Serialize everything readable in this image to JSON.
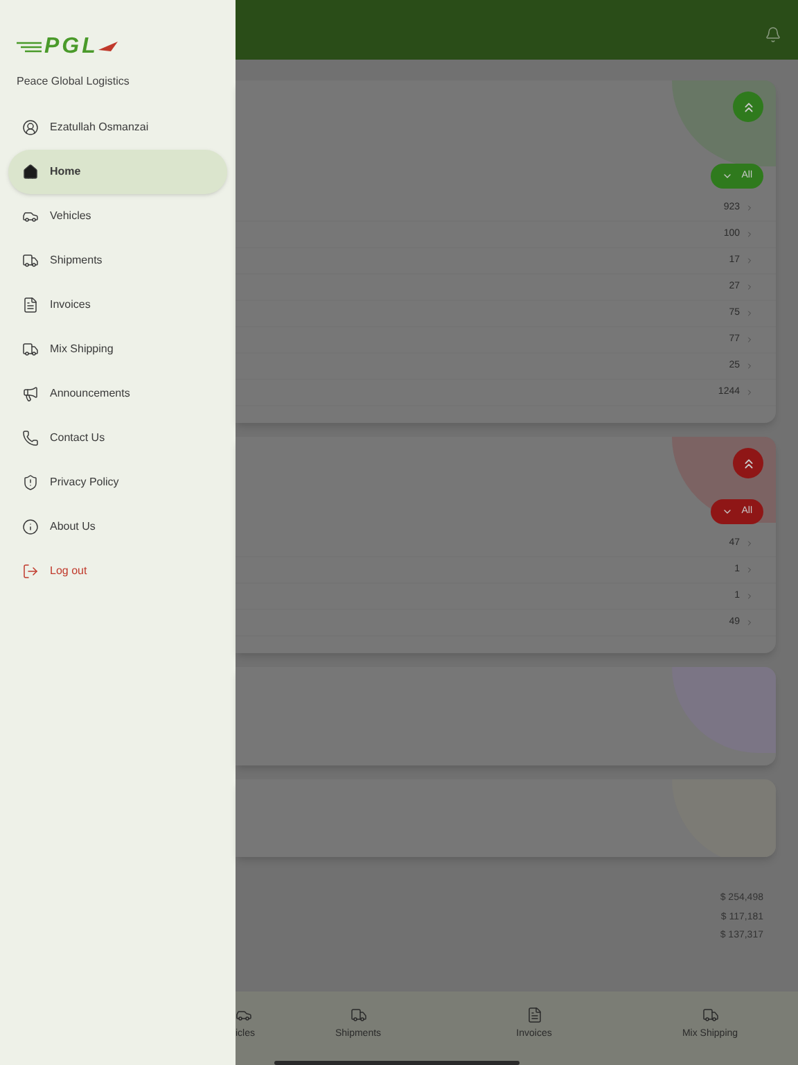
{
  "drawer": {
    "logo_text": "PGL",
    "company": "Peace Global Logistics",
    "items": [
      {
        "kind": "user",
        "label": "Ezatullah Osmanzai",
        "selected": false
      },
      {
        "kind": "link",
        "label": "Home",
        "selected": true
      },
      {
        "kind": "link",
        "label": "Vehicles",
        "selected": false
      },
      {
        "kind": "link",
        "label": "Shipments",
        "selected": false
      },
      {
        "kind": "link",
        "label": "Invoices",
        "selected": false
      },
      {
        "kind": "link",
        "label": "Mix Shipping",
        "selected": false
      },
      {
        "kind": "link",
        "label": "Announcements",
        "selected": false
      },
      {
        "kind": "link",
        "label": "Contact Us",
        "selected": false
      },
      {
        "kind": "link",
        "label": "Privacy Policy",
        "selected": false
      },
      {
        "kind": "link",
        "label": "About Us",
        "selected": false
      },
      {
        "kind": "logout",
        "label": "Log out",
        "selected": false
      }
    ]
  },
  "cards": [
    {
      "color": "#2f7a1d",
      "filter": "All",
      "rows": [
        "923",
        "100",
        "17",
        "27",
        "75",
        "77",
        "25",
        "1244"
      ]
    },
    {
      "color": "#8f1616",
      "filter": "All",
      "rows": [
        "47",
        "1",
        "1",
        "49"
      ]
    },
    {
      "color": "#7b7585"
    },
    {
      "color": "#7c7b75"
    }
  ],
  "totals": [
    "$ 254,498",
    "$ 117,181",
    "$ 137,317"
  ],
  "bottom_nav": [
    {
      "label": "icles"
    },
    {
      "label": "Shipments"
    },
    {
      "label": "Invoices"
    },
    {
      "label": "Mix Shipping"
    }
  ]
}
